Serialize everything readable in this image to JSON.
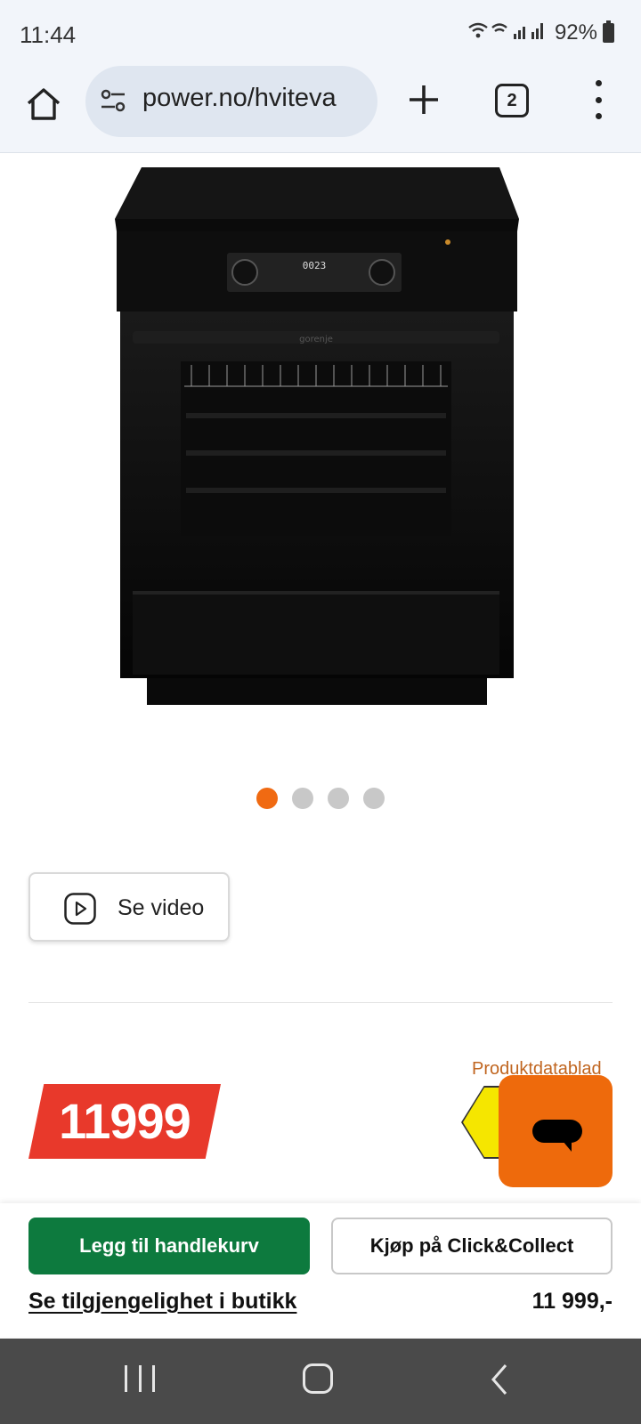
{
  "status_bar": {
    "time": "11:44",
    "icons": [
      "wifi-icon",
      "wifi-call-icon",
      "signal-icon",
      "signal-icon"
    ],
    "battery": "92%"
  },
  "browser": {
    "url": "power.no/hviteva",
    "tab_count": "2"
  },
  "product": {
    "image": "black-gorenje-electric-range-oven",
    "carousel": {
      "count": 4,
      "active_index": 0,
      "active_color": "#f06a12",
      "inactive_color": "#c8c8c8"
    }
  },
  "video_button": {
    "label": "Se video"
  },
  "price": {
    "badge": "11999",
    "badge_color": "#e8392b",
    "datasheet_link": "Produktdatablad",
    "formatted": "11 999,-"
  },
  "chat": {
    "color": "#ee6a0c"
  },
  "actions": {
    "cart_label": "Legg til handlekurv",
    "cart_color": "#0d7a3e",
    "collect_label": "Kjøp på Click&Collect",
    "availability_link": "Se tilgjengelighet i butikk"
  }
}
